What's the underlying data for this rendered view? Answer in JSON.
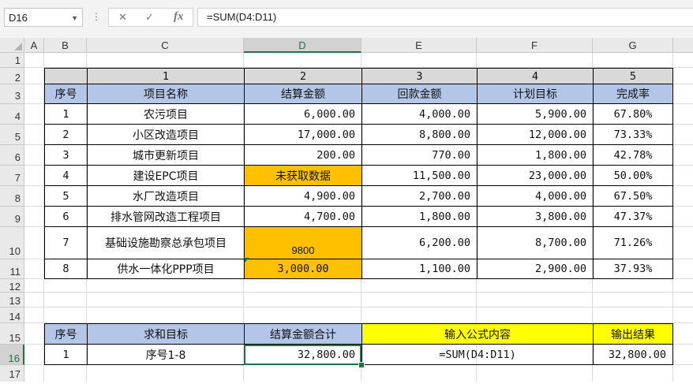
{
  "namebox": {
    "value": "D16"
  },
  "toolbar": {
    "cancel": "✕",
    "enter": "✓",
    "fx": "fx",
    "dots": "⋮"
  },
  "formula_bar": {
    "value": "=SUM(D4:D11)"
  },
  "columns": [
    "A",
    "B",
    "C",
    "D",
    "E",
    "F",
    "G"
  ],
  "rows": [
    "1",
    "2",
    "3",
    "4",
    "5",
    "6",
    "7",
    "8",
    "9",
    "10",
    "11",
    "12",
    "13",
    "14",
    "15",
    "16",
    "17"
  ],
  "selected_cell": "D16",
  "table": {
    "numbers": [
      "1",
      "2",
      "3",
      "4",
      "5"
    ],
    "headers": [
      "序号",
      "项目名称",
      "结算金额",
      "回款金额",
      "计划目标",
      "完成率"
    ],
    "rows": [
      [
        "1",
        "农污项目",
        "6,000.00",
        "4,000.00",
        "5,900.00",
        "67.80%"
      ],
      [
        "2",
        "小区改造项目",
        "17,000.00",
        "8,800.00",
        "12,000.00",
        "73.33%"
      ],
      [
        "3",
        "城市更新项目",
        "200.00",
        "770.00",
        "1,800.00",
        "42.78%"
      ],
      [
        "4",
        "建设EPC项目",
        "未获取数据",
        "11,500.00",
        "23,000.00",
        "50.00%"
      ],
      [
        "5",
        "水厂改造项目",
        "4,900.00",
        "2,700.00",
        "4,000.00",
        "67.50%"
      ],
      [
        "6",
        "排水管网改造工程项目",
        "4,700.00",
        "1,800.00",
        "3,800.00",
        "47.37%"
      ],
      [
        "7",
        "基础设施勘察总承包项目",
        "9800",
        "6,200.00",
        "8,700.00",
        "71.26%"
      ],
      [
        "8",
        "供水一体化PPP项目",
        "3,000.00",
        "1,100.00",
        "2,900.00",
        "37.93%"
      ]
    ]
  },
  "summary": {
    "headers": [
      "序号",
      "求和目标",
      "结算金额合计",
      "输入公式内容",
      "输出结果"
    ],
    "row": [
      "1",
      "序号1-8",
      "32,800.00",
      "=SUM(D4:D11)",
      "32,800.00"
    ]
  },
  "colors": {
    "header_blue": "#b4c6e7",
    "highlight_orange": "#ffc000",
    "highlight_yellow": "#ffff00",
    "excel_green": "#217346",
    "number_row_gray": "#d9d9d9"
  }
}
